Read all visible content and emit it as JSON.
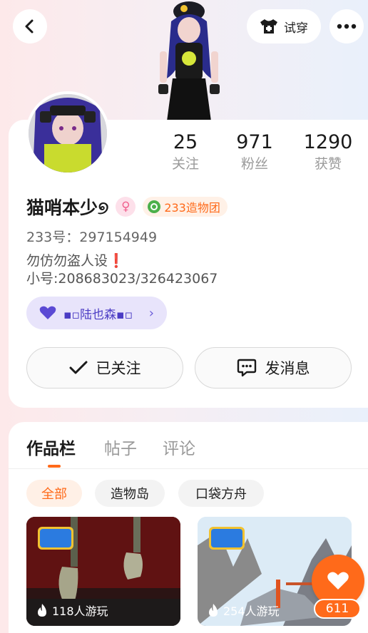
{
  "header": {
    "tryon_label": "试穿"
  },
  "profile": {
    "stats": [
      {
        "value": "25",
        "label": "关注"
      },
      {
        "value": "971",
        "label": "粉丝"
      },
      {
        "value": "1290",
        "label": "获赞"
      }
    ],
    "name": "猫哨本少୭",
    "gender_symbol": "♀",
    "team_label": "233造物团",
    "uid_text": "233号：297154949",
    "bio_line1": "勿仿勿盗人设",
    "bio_mark": "❗",
    "bio_line2": "小号:208683023/326423067",
    "couple_name": "▪▫陆也森▪▫",
    "follow_button": "已关注",
    "message_button": "发消息"
  },
  "works": {
    "tabs": [
      "作品栏",
      "帖子",
      "评论"
    ],
    "filters": [
      "全部",
      "造物岛",
      "口袋方舟"
    ],
    "games": [
      {
        "logo": "233造物岛",
        "plays": "118人游玩"
      },
      {
        "logo": "233造物岛",
        "plays": "254人游玩"
      }
    ]
  },
  "like": {
    "count": "611"
  },
  "colors": {
    "accent": "#ff6a1a",
    "couple_bg": "#e8e4fb",
    "couple_text": "#4b3cc4"
  },
  "icons": [
    "back-arrow-icon",
    "tshirt-icon",
    "more-dots-icon",
    "check-icon",
    "message-icon",
    "heart-icon",
    "flame-icon",
    "chevron-right-icon",
    "female-icon",
    "team-emblem-icon"
  ]
}
